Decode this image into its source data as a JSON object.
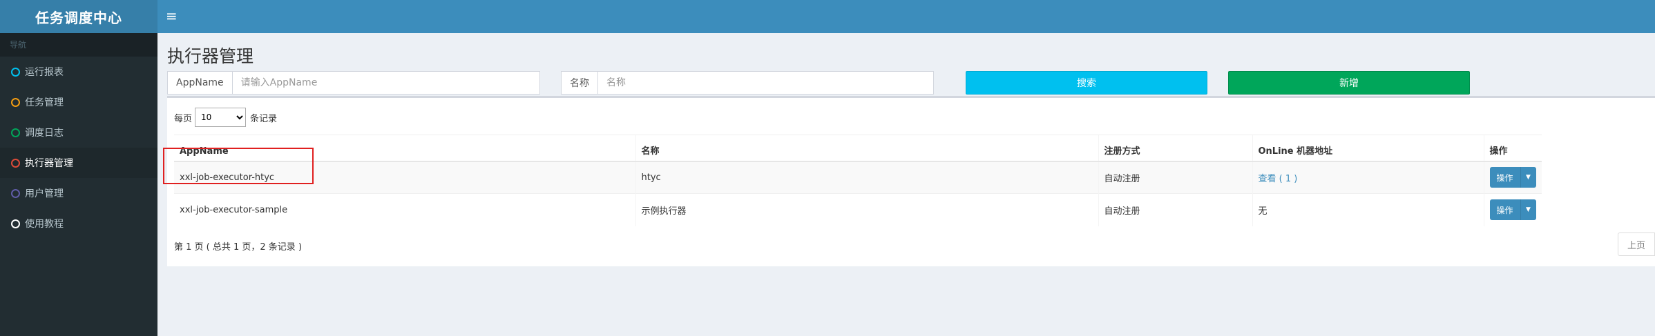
{
  "app": {
    "title": "任务调度中心"
  },
  "sidebar": {
    "header": "导航",
    "items": [
      {
        "label": "运行报表",
        "color": "#00c0ef"
      },
      {
        "label": "任务管理",
        "color": "#f39c12"
      },
      {
        "label": "调度日志",
        "color": "#00a65a"
      },
      {
        "label": "执行器管理",
        "color": "#dd4b39",
        "active": true
      },
      {
        "label": "用户管理",
        "color": "#605ca8"
      },
      {
        "label": "使用教程",
        "color": "#ffffff"
      }
    ]
  },
  "header": {
    "toggle_icon": "menu-icon"
  },
  "page": {
    "title": "执行器管理"
  },
  "search": {
    "appname_label": "AppName",
    "appname_placeholder": "请输入AppName",
    "name_label": "名称",
    "name_placeholder": "名称",
    "search_button": "搜索",
    "add_button": "新增"
  },
  "table": {
    "length_prefix": "每页",
    "length_value": "10",
    "length_suffix": "条记录",
    "columns": [
      "AppName",
      "名称",
      "注册方式",
      "OnLine 机器地址",
      "操作"
    ],
    "rows": [
      {
        "appname": "xxl-job-executor-htyc",
        "name": "htyc",
        "reg": "自动注册",
        "online": "查看 ( 1 )",
        "op": "操作"
      },
      {
        "appname": "xxl-job-executor-sample",
        "name": "示例执行器",
        "reg": "自动注册",
        "online": "无",
        "op": "操作"
      }
    ],
    "info": "第 1 页 ( 总共 1 页，2 条记录 )",
    "prev": "上页"
  }
}
